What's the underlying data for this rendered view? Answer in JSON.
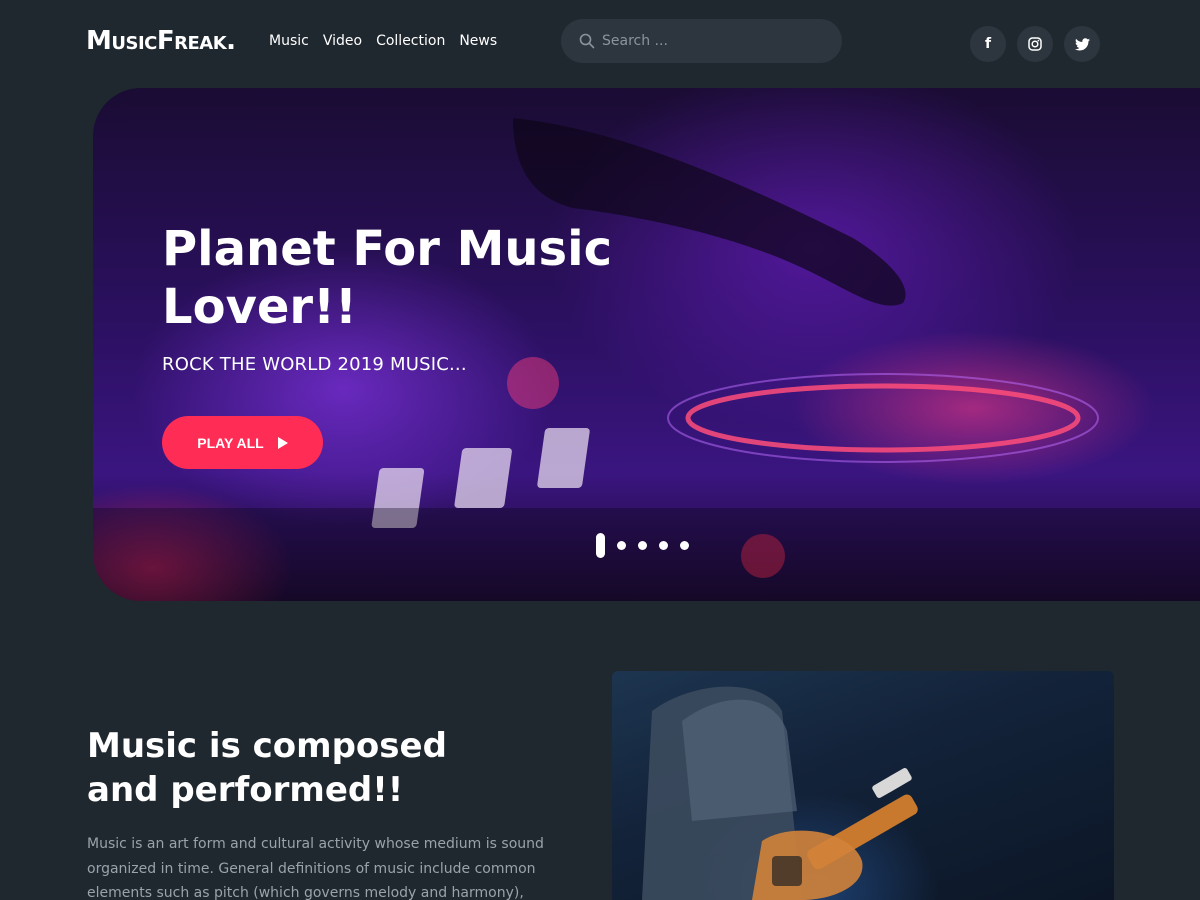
{
  "header": {
    "logo": "MusicFreak.",
    "nav": [
      "Music",
      "Video",
      "Collection",
      "News"
    ],
    "search": {
      "placeholder": "Search ..."
    },
    "socials": [
      {
        "icon": "facebook-icon",
        "glyph": "f"
      },
      {
        "icon": "instagram-icon",
        "glyph": ""
      },
      {
        "icon": "twitter-icon",
        "glyph": ""
      }
    ]
  },
  "hero": {
    "title": "Planet For Music Lover!!",
    "subtitle": "ROCK THE WORLD 2019 MUSIC...",
    "play_button": "PLAY ALL",
    "slides_count": 5,
    "active_slide": 1
  },
  "about": {
    "title": "Music is composed and performed!!",
    "text": "Music is an art form and cultural activity whose medium is sound organized in time. General definitions of music include common elements such as pitch (which governs melody and harmony), rhythm (and its"
  },
  "colors": {
    "background": "#1f272f",
    "surface": "#2d363f",
    "accent": "#ff2d55",
    "muted_text": "#9aa2aa"
  }
}
